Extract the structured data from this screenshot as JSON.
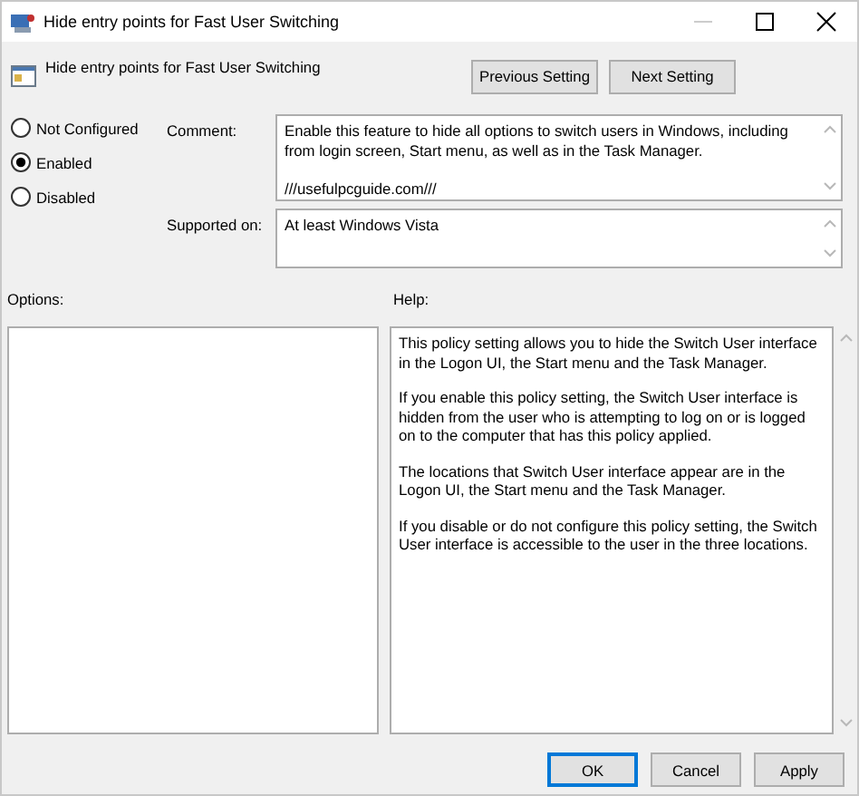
{
  "window": {
    "title": "Hide entry points for Fast User Switching"
  },
  "header": {
    "title": "Hide entry points for Fast User Switching",
    "buttons": [
      "Previous Setting",
      "Next Setting"
    ]
  },
  "state_options": [
    {
      "label": "Not Configured",
      "selected": false
    },
    {
      "label": "Enabled",
      "selected": true
    },
    {
      "label": "Disabled",
      "selected": false
    }
  ],
  "comment": {
    "label": "Comment:",
    "value": "Enable this feature to hide all options to switch users in Windows, including from login screen, Start menu, as well as in the Task Manager.\n\n///usefulpcguide.com///"
  },
  "supported_on": {
    "label": "Supported on:",
    "value": "At least Windows Vista"
  },
  "options": {
    "label": "Options:"
  },
  "help": {
    "label": "Help:",
    "paragraphs": [
      "This policy setting allows you to hide the Switch User interface in the Logon UI, the Start menu and the Task Manager.",
      "If you enable this policy setting, the Switch User interface is hidden from the user who is attempting to log on or is logged on to the computer that has this policy applied.",
      "The locations that Switch User interface appear are in the Logon UI, the Start menu and the Task Manager.",
      "If you disable or do not configure this policy setting, the Switch User interface is accessible to the user in the three locations."
    ]
  },
  "footer_buttons": [
    {
      "label": "OK",
      "default": true
    },
    {
      "label": "Cancel",
      "default": false
    },
    {
      "label": "Apply",
      "default": false
    }
  ]
}
